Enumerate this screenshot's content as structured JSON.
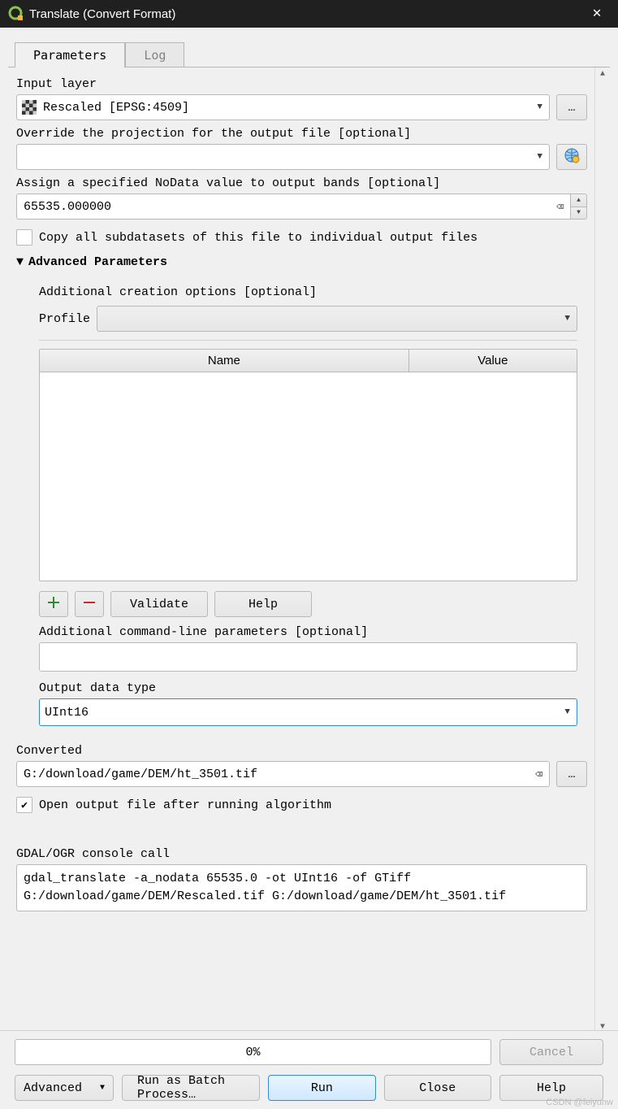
{
  "window": {
    "title": "Translate (Convert Format)"
  },
  "tabs": {
    "parameters": "Parameters",
    "log": "Log"
  },
  "params": {
    "input_layer_label": "Input layer",
    "input_layer_value": "Rescaled [EPSG:4509]",
    "override_proj_label": "Override the projection for the output file [optional]",
    "override_proj_value": "",
    "nodata_label": "Assign a specified NoData value to output bands [optional]",
    "nodata_value": "65535.000000",
    "copy_subdatasets_label": "Copy all subdatasets of this file to individual output files",
    "advanced_header": "Advanced Parameters",
    "additional_options_label": "Additional creation options [optional]",
    "profile_label": "Profile",
    "table": {
      "col_name": "Name",
      "col_value": "Value"
    },
    "validate_btn": "Validate",
    "help_btn": "Help",
    "addl_cmdline_label": "Additional command-line parameters [optional]",
    "addl_cmdline_value": "",
    "output_type_label": "Output data type",
    "output_type_value": "UInt16",
    "converted_label": "Converted",
    "converted_value": "G:/download/game/DEM/ht_3501.tif",
    "open_output_label": "Open output file after running algorithm",
    "console_label": "GDAL/OGR console call",
    "console_value": "gdal_translate -a_nodata 65535.0 -ot UInt16 -of GTiff G:/download/game/DEM/Rescaled.tif G:/download/game/DEM/ht_3501.tif"
  },
  "footer": {
    "progress_text": "0%",
    "cancel": "Cancel",
    "advanced": "Advanced",
    "run_batch": "Run as Batch Process…",
    "run": "Run",
    "close": "Close",
    "help": "Help"
  },
  "watermark": "CSDN @feiyunw"
}
